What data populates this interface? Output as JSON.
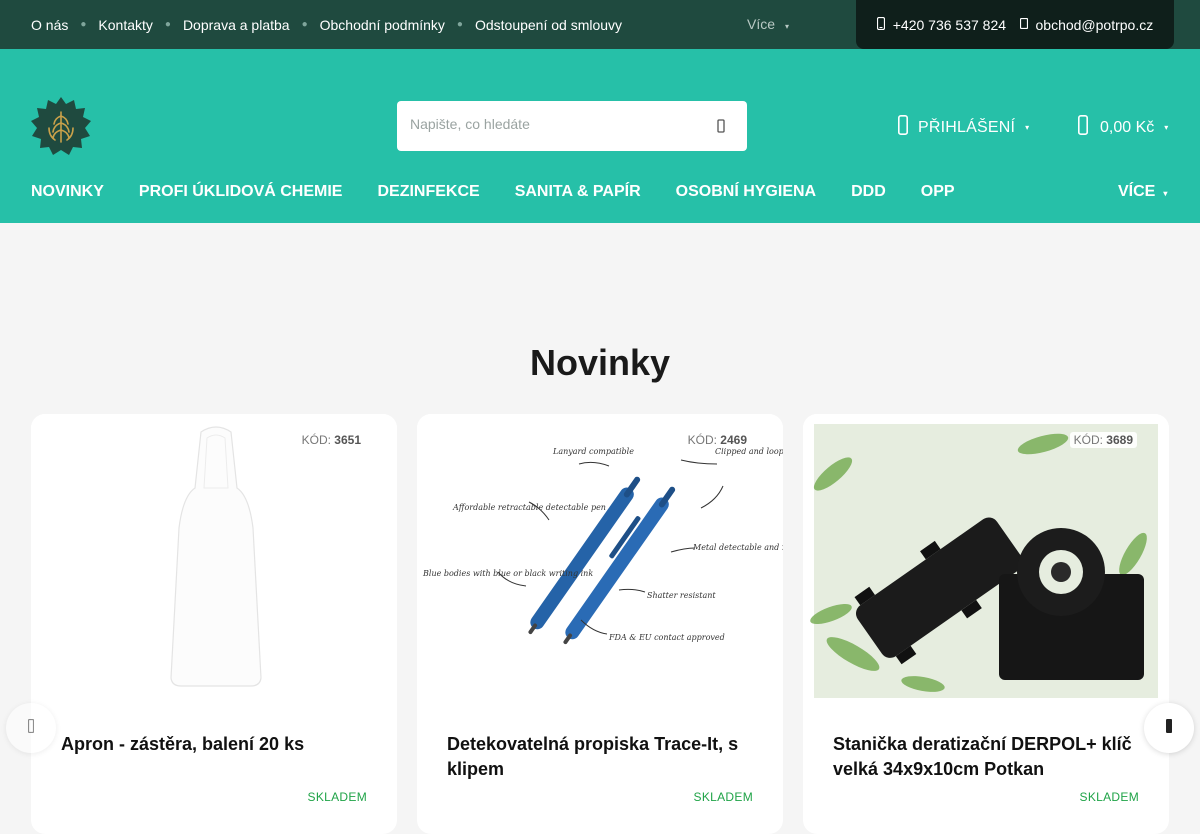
{
  "topbar": {
    "links": [
      "O nás",
      "Kontakty",
      "Doprava a platba",
      "Obchodní podmínky",
      "Odstoupení od smlouvy"
    ],
    "more": "Více",
    "phone": "+420 736 537 824",
    "email": "obchod@potrpo.cz"
  },
  "header": {
    "search_placeholder": "Napište, co hledáte",
    "login": "PŘIHLÁŠENÍ",
    "cart_total": "0,00 Kč",
    "nav": [
      "NOVINKY",
      "PROFI ÚKLIDOVÁ CHEMIE",
      "DEZINFEKCE",
      "SANITA & PAPÍR",
      "OSOBNÍ HYGIENA",
      "DDD",
      "OPP"
    ],
    "nav_more": "VÍCE"
  },
  "main": {
    "title": "Novinky",
    "products": [
      {
        "code_label": "KÓD:",
        "code": "3651",
        "name": "Apron - zástěra, balení 20 ks",
        "stock": "SKLADEM"
      },
      {
        "code_label": "KÓD:",
        "code": "2469",
        "name": "Detekovatelná propiska Trace-It, s klipem",
        "stock": "SKLADEM"
      },
      {
        "code_label": "KÓD:",
        "code": "3689",
        "name": "Stanička deratizační DERPOL+ klíč velká 34x9x10cm Potkan",
        "stock": "SKLADEM"
      }
    ],
    "pen_annotations": [
      "Lanyard compatible",
      "Clipped and looped versions available",
      "Affordable retractable detectable pen",
      "Metal detectable and x-ray visible parts",
      "Blue bodies with blue or black writing ink",
      "Shatter resistant",
      "FDA & EU contact approved"
    ]
  },
  "colors": {
    "topbar": "#1f4a3f",
    "brand": "#26c0a8",
    "stock": "#1fa347"
  }
}
